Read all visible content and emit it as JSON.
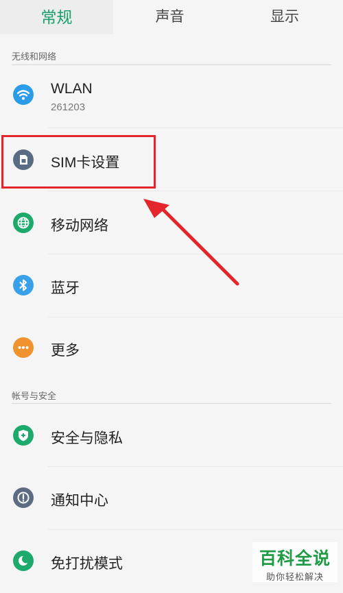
{
  "tabs": [
    {
      "label": "常规"
    },
    {
      "label": "声音"
    },
    {
      "label": "显示"
    }
  ],
  "sections": [
    {
      "title": "无线和网络",
      "items": [
        {
          "label": "WLAN",
          "sublabel": "261203",
          "icon": "wifi-icon",
          "color": "#2b9de8"
        },
        {
          "label": "SIM卡设置",
          "icon": "sim-card-icon",
          "color": "#5a6b84"
        },
        {
          "label": "移动网络",
          "icon": "globe-icon",
          "color": "#1caa6b"
        },
        {
          "label": "蓝牙",
          "icon": "bluetooth-icon",
          "color": "#3aa0ea"
        },
        {
          "label": "更多",
          "icon": "more-dots-icon",
          "color": "#f0932e"
        }
      ]
    },
    {
      "title": "帐号与安全",
      "items": [
        {
          "label": "安全与隐私",
          "icon": "shield-icon",
          "color": "#1eaa6c"
        },
        {
          "label": "通知中心",
          "icon": "notification-icon",
          "color": "#5d6c83"
        },
        {
          "label": "免打扰模式",
          "icon": "moon-icon",
          "color": "#1eaa6c"
        }
      ]
    }
  ],
  "watermark": {
    "title": "百科全说",
    "subtitle": "助你轻松解决"
  },
  "colors": {
    "accent": "#18a06a",
    "highlight": "#e4262c"
  }
}
